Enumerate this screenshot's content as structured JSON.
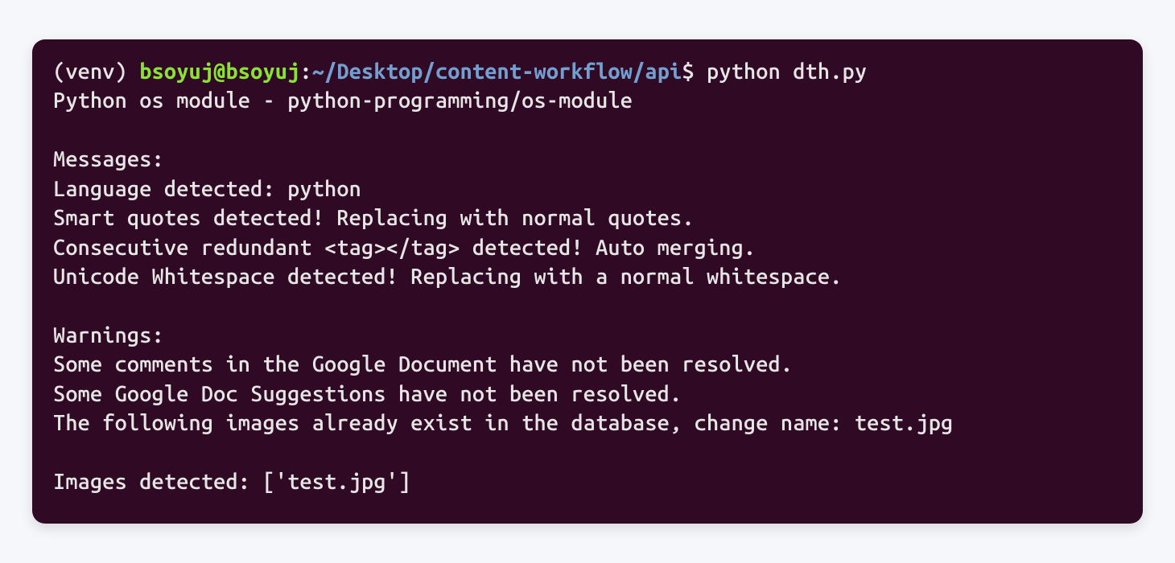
{
  "terminal": {
    "prompt": {
      "venv": "(venv) ",
      "user_host": "bsoyuj@bsoyuj",
      "colon": ":",
      "path": "~/Desktop/content-workflow/api",
      "dollar": "$ ",
      "command": "python dth.py"
    },
    "output": {
      "line1": "Python os module - python-programming/os-module",
      "blank1": "",
      "messages_header": "Messages:",
      "msg1": "Language detected: python",
      "msg2": "Smart quotes detected! Replacing with normal quotes.",
      "msg3": "Consecutive redundant <tag></tag> detected! Auto merging.",
      "msg4": "Unicode Whitespace detected! Replacing with a normal whitespace.",
      "blank2": "",
      "warnings_header": "Warnings:",
      "warn1": "Some comments in the Google Document have not been resolved.",
      "warn2": "Some Google Doc Suggestions have not been resolved.",
      "warn3": "The following images already exist in the database, change name: test.jpg",
      "blank3": "",
      "images_line": "Images detected: ['test.jpg']"
    }
  }
}
